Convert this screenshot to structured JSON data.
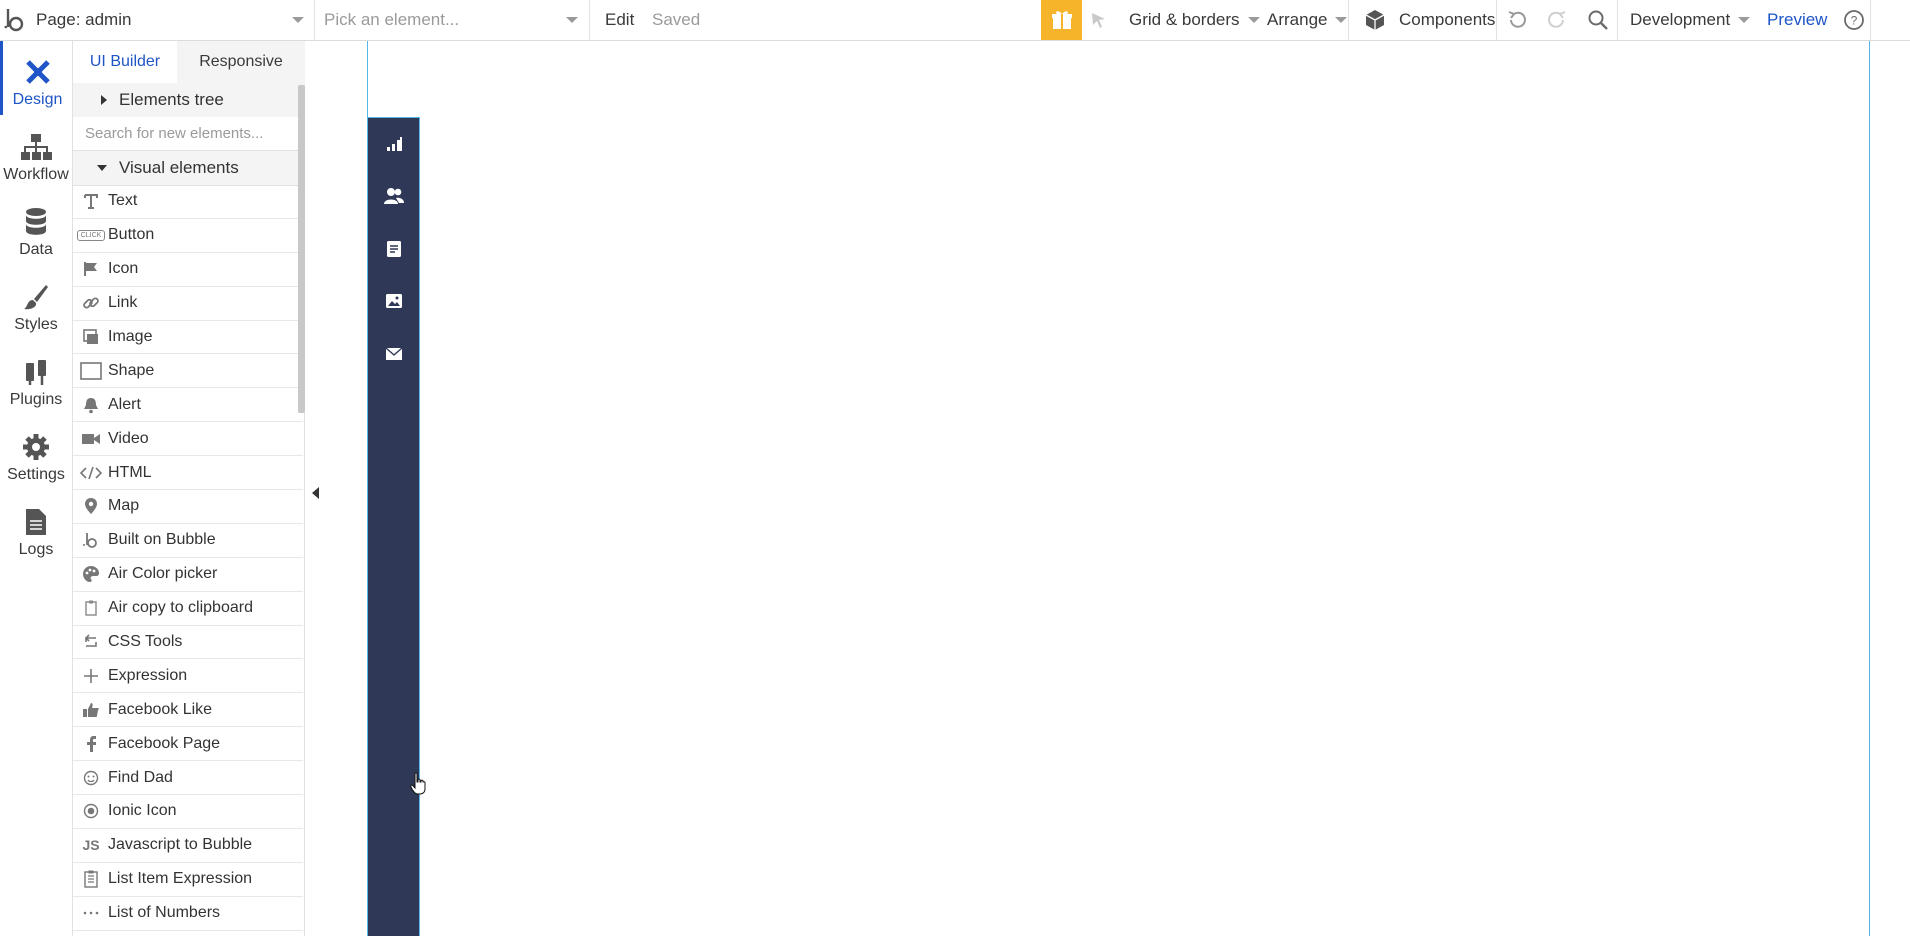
{
  "topbar": {
    "page_label": "Page: admin",
    "pick_placeholder": "Pick an element...",
    "edit_label": "Edit",
    "saved_label": "Saved",
    "grid_label": "Grid & borders",
    "arrange_label": "Arrange",
    "components_label": "Components",
    "environment_label": "Development",
    "preview_label": "Preview"
  },
  "rail": {
    "items": [
      {
        "label": "Design",
        "icon": "design-icon"
      },
      {
        "label": "Workflow",
        "icon": "workflow-icon"
      },
      {
        "label": "Data",
        "icon": "database-icon"
      },
      {
        "label": "Styles",
        "icon": "brush-icon"
      },
      {
        "label": "Plugins",
        "icon": "plug-icon"
      },
      {
        "label": "Settings",
        "icon": "gear-icon"
      },
      {
        "label": "Logs",
        "icon": "document-icon"
      }
    ]
  },
  "panel": {
    "tabs": [
      "UI Builder",
      "Responsive"
    ],
    "elements_tree": "Elements tree",
    "search_placeholder": "Search for new elements...",
    "visual_elements": "Visual elements",
    "items": [
      {
        "label": "Text",
        "icon": "text-icon"
      },
      {
        "label": "Button",
        "icon": "button-icon"
      },
      {
        "label": "Icon",
        "icon": "flag-icon"
      },
      {
        "label": "Link",
        "icon": "link-icon"
      },
      {
        "label": "Image",
        "icon": "image-icon"
      },
      {
        "label": "Shape",
        "icon": "shape-icon"
      },
      {
        "label": "Alert",
        "icon": "bell-icon"
      },
      {
        "label": "Video",
        "icon": "video-icon"
      },
      {
        "label": "HTML",
        "icon": "code-icon"
      },
      {
        "label": "Map",
        "icon": "map-pin-icon"
      },
      {
        "label": "Built on Bubble",
        "icon": "bubble-logo-icon"
      },
      {
        "label": "Air Color picker",
        "icon": "palette-icon"
      },
      {
        "label": "Air copy to clipboard",
        "icon": "clipboard-icon"
      },
      {
        "label": "CSS Tools",
        "icon": "css-tools-icon"
      },
      {
        "label": "Expression",
        "icon": "plus-icon"
      },
      {
        "label": "Facebook Like",
        "icon": "thumbs-up-icon"
      },
      {
        "label": "Facebook Page",
        "icon": "facebook-icon"
      },
      {
        "label": "Find Dad",
        "icon": "smiley-icon"
      },
      {
        "label": "Ionic Icon",
        "icon": "ionic-icon"
      },
      {
        "label": "Javascript to Bubble",
        "icon": "js-icon"
      },
      {
        "label": "List Item Expression",
        "icon": "list-expression-icon"
      },
      {
        "label": "List of Numbers",
        "icon": "dots-icon"
      }
    ],
    "button_icon_text": "CLICK",
    "js_icon_text": "JS"
  },
  "canvas": {
    "sidebar_icons": [
      "bar-chart-icon",
      "users-icon",
      "note-icon",
      "image-icon",
      "mail-icon"
    ]
  },
  "colors": {
    "accent": "#1f55c7",
    "gift": "#f6b42a",
    "sidebar_bg": "#2f3856",
    "frame_border": "#56b6e6"
  }
}
